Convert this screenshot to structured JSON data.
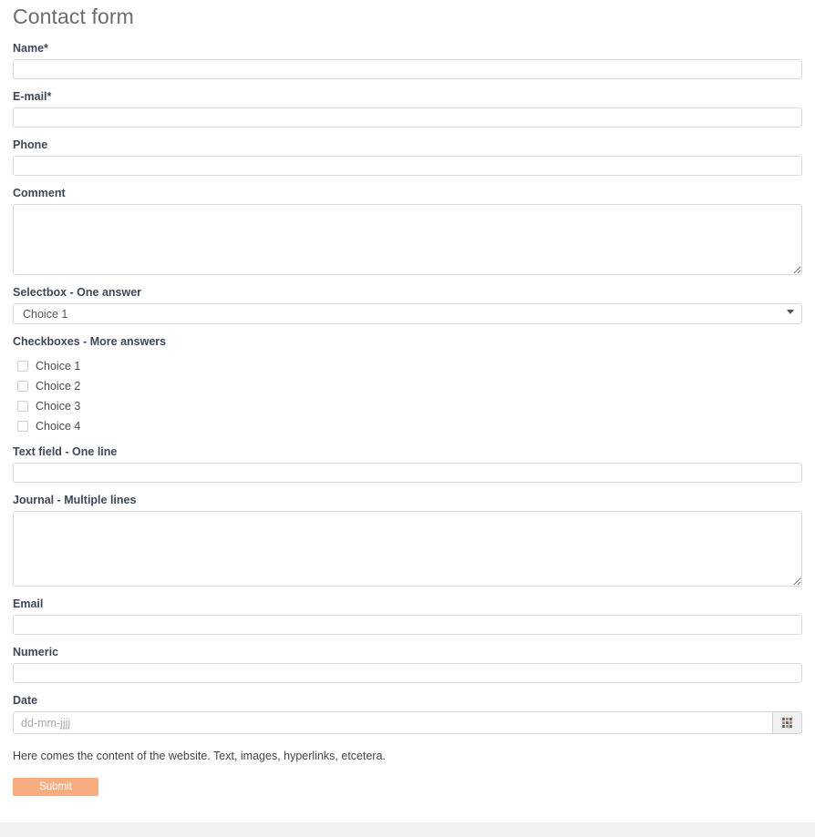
{
  "page": {
    "title": "Contact form",
    "content_text": "Here comes the content of the website. Text, images, hyperlinks, etcetera.",
    "submit_label": "Submit",
    "accent_color": "#f7ad80",
    "label_color": "#3c4858",
    "border_color": "#d8d8d8"
  },
  "fields": {
    "name": {
      "label": "Name*",
      "value": "",
      "placeholder": ""
    },
    "email_required": {
      "label": "E-mail*",
      "value": "",
      "placeholder": ""
    },
    "phone": {
      "label": "Phone",
      "value": "",
      "placeholder": ""
    },
    "comment": {
      "label": "Comment",
      "value": "",
      "placeholder": ""
    },
    "selectbox": {
      "label": "Selectbox - One answer",
      "selected": "Choice 1",
      "options": [
        "Choice 1"
      ]
    },
    "checkboxes": {
      "label": "Checkboxes - More answers",
      "items": [
        {
          "label": "Choice 1",
          "checked": false
        },
        {
          "label": "Choice 2",
          "checked": false
        },
        {
          "label": "Choice 3",
          "checked": false
        },
        {
          "label": "Choice 4",
          "checked": false
        }
      ]
    },
    "text_field": {
      "label": "Text field - One line",
      "value": "",
      "placeholder": ""
    },
    "journal": {
      "label": "Journal - Multiple lines",
      "value": "",
      "placeholder": ""
    },
    "email": {
      "label": "Email",
      "value": "",
      "placeholder": ""
    },
    "numeric": {
      "label": "Numeric",
      "value": "",
      "placeholder": ""
    },
    "date": {
      "label": "Date",
      "value": "",
      "placeholder": "dd-mm-jjjj"
    }
  },
  "icons": {
    "calendar": "calendar-icon",
    "select_arrow": "chevron-down-icon"
  }
}
